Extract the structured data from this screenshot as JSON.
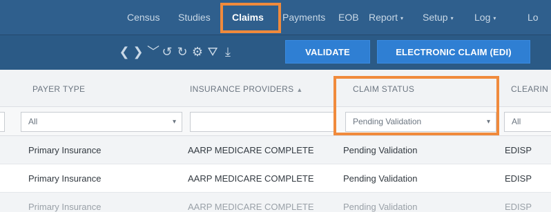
{
  "nav": {
    "items": [
      {
        "label": "Census",
        "active": false
      },
      {
        "label": "Studies",
        "active": false
      },
      {
        "label": "Claims",
        "active": true
      },
      {
        "label": "Payments",
        "active": false
      },
      {
        "label": "EOB",
        "active": false
      },
      {
        "label": "Report",
        "active": false,
        "dropdown": true
      },
      {
        "label": "Setup",
        "active": false,
        "dropdown": true
      },
      {
        "label": "Log",
        "active": false,
        "dropdown": true
      },
      {
        "label": "Lo",
        "active": false
      }
    ],
    "caret": "▾"
  },
  "toolbar": {
    "icons": [
      {
        "name": "chevron-left-icon",
        "glyph": "❮"
      },
      {
        "name": "chevron-right-icon",
        "glyph": "❯"
      },
      {
        "name": "chevron-down-icon",
        "glyph": "﹀"
      },
      {
        "name": "undo-icon",
        "glyph": "↺"
      },
      {
        "name": "refresh-icon",
        "glyph": "↻"
      },
      {
        "name": "gear-icon",
        "glyph": "⚙"
      },
      {
        "name": "filter-icon",
        "glyph": "⛛"
      },
      {
        "name": "download-icon",
        "glyph": "⤓"
      }
    ],
    "validate_label": "VALIDATE",
    "edi_label": "ELECTRONIC CLAIM (EDI)"
  },
  "grid": {
    "columns": [
      {
        "label": "PAYER TYPE"
      },
      {
        "label": "INSURANCE PROVIDERS",
        "sort": "▲"
      },
      {
        "label": "CLAIM STATUS"
      },
      {
        "label": "CLEARIN"
      }
    ],
    "filters": [
      {
        "value": "All",
        "has_dropdown": true
      },
      {
        "value": "",
        "has_dropdown": false
      },
      {
        "value": "Pending Validation",
        "has_dropdown": true
      },
      {
        "value": "All",
        "has_dropdown": false
      }
    ],
    "dropdown_glyph": "▾",
    "rows": [
      [
        "Primary Insurance",
        "AARP MEDICARE COMPLETE",
        "Pending Validation",
        "EDISP"
      ],
      [
        "Primary Insurance",
        "AARP MEDICARE COMPLETE",
        "Pending Validation",
        "EDISP"
      ],
      [
        "Primary Insurance",
        "AARP MEDICARE COMPLETE",
        "Pending Validation",
        "EDISP"
      ]
    ]
  },
  "colors": {
    "nav_bg": "#2f5f8d",
    "button_bg": "#2f7fd3",
    "highlight": "#f08a3c"
  }
}
